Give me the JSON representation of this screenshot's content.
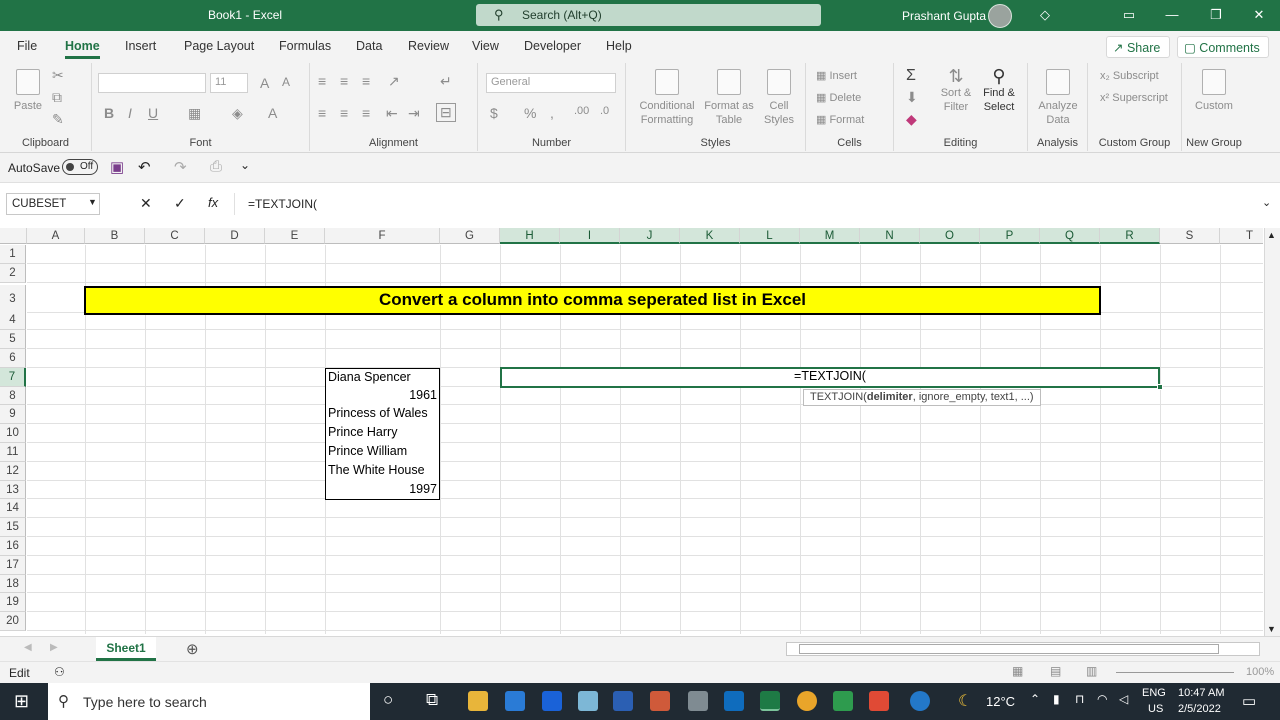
{
  "window": {
    "title": "Book1  -  Excel",
    "search_placeholder": "Search (Alt+Q)",
    "user": "Prashant Gupta"
  },
  "tabs": [
    "File",
    "Home",
    "Insert",
    "Page Layout",
    "Formulas",
    "Data",
    "Review",
    "View",
    "Developer",
    "Help"
  ],
  "active_tab": "Home",
  "share_label": "Share",
  "comments_label": "Comments",
  "ribbon": {
    "clipboard": {
      "label": "Clipboard",
      "paste": "Paste"
    },
    "font": {
      "label": "Font",
      "size": "11"
    },
    "alignment": {
      "label": "Alignment"
    },
    "number": {
      "label": "Number",
      "format": "General"
    },
    "styles": {
      "label": "Styles",
      "conditional": "Conditional\nFormatting",
      "format_table": "Format as\nTable",
      "cell_styles": "Cell\nStyles"
    },
    "cells": {
      "label": "Cells",
      "insert": "Insert",
      "delete": "Delete",
      "format": "Format"
    },
    "editing": {
      "label": "Editing",
      "sort": "Sort &\nFilter",
      "find": "Find &\nSelect"
    },
    "analysis": {
      "label": "Analysis",
      "analyze": "Analyze\nData"
    },
    "custom_group": {
      "label": "Custom Group",
      "subscript": "Subscript",
      "superscript": "Superscript"
    },
    "new_group": {
      "label": "New Group",
      "custom": "Custom"
    }
  },
  "qat": {
    "autosave": "AutoSave",
    "toggle": "Off"
  },
  "formula_bar": {
    "name_box": "CUBESET",
    "formula": "=TEXTJOIN("
  },
  "columns": [
    "A",
    "B",
    "C",
    "D",
    "E",
    "F",
    "G",
    "H",
    "I",
    "J",
    "K",
    "L",
    "M",
    "N",
    "O",
    "P",
    "Q",
    "R",
    "S",
    "T"
  ],
  "rows": [
    "1",
    "2",
    "3",
    "4",
    "5",
    "6",
    "7",
    "8",
    "9",
    "10",
    "11",
    "12",
    "13",
    "14",
    "15",
    "16",
    "17",
    "18",
    "19",
    "20"
  ],
  "title_banner": "Convert a column into comma seperated list in Excel",
  "list": [
    {
      "row": "7",
      "text": "Diana Spencer",
      "align": "left"
    },
    {
      "row": "8",
      "text": "1961",
      "align": "right"
    },
    {
      "row": "9",
      "text": "Princess of Wales",
      "align": "left"
    },
    {
      "row": "10",
      "text": "Prince Harry",
      "align": "left"
    },
    {
      "row": "11",
      "text": "Prince William",
      "align": "left"
    },
    {
      "row": "12",
      "text": "The White House",
      "align": "left"
    },
    {
      "row": "13",
      "text": "1997",
      "align": "right"
    }
  ],
  "active_cell": {
    "text": "=TEXTJOIN(",
    "tooltip_fn": "TEXTJOIN(",
    "tooltip_bold": "delimiter",
    "tooltip_rest": ", ignore_empty, text1, ...)"
  },
  "sheets": [
    "Sheet1"
  ],
  "status": {
    "mode": "Edit",
    "zoom": "100%"
  },
  "taskbar": {
    "search": "Type here to search",
    "temp": "12°C",
    "lang1": "ENG",
    "lang2": "US",
    "time": "10:47 AM",
    "date": "2/5/2022"
  },
  "colors": {
    "excel_green": "#217346",
    "banner": "#ffff00"
  }
}
